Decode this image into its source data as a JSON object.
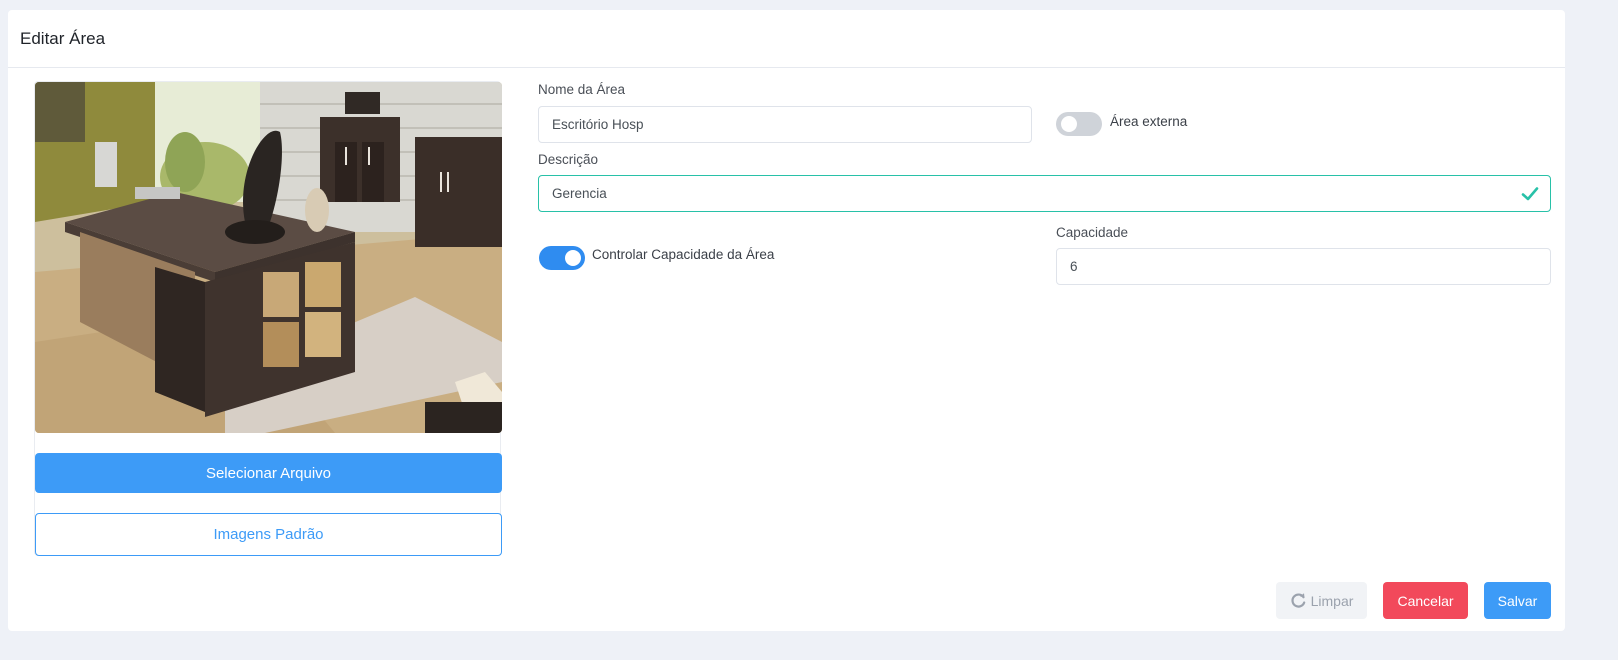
{
  "header": {
    "title": "Editar Área"
  },
  "image_panel": {
    "select_file_label": "Selecionar Arquivo",
    "default_images_label": "Imagens Padrão"
  },
  "form": {
    "area_name": {
      "label": "Nome da Área",
      "value": "Escritório Hosp"
    },
    "external_area": {
      "label": "Área externa",
      "checked": false
    },
    "description": {
      "label": "Descrição",
      "value": "Gerencia",
      "valid": true
    },
    "control_capacity": {
      "label": "Controlar Capacidade da Área",
      "checked": true
    },
    "capacity": {
      "label": "Capacidade",
      "value": "6"
    }
  },
  "actions": {
    "reset_label": "Limpar",
    "cancel_label": "Cancelar",
    "save_label": "Salvar"
  },
  "colors": {
    "primary": "#3d9bf7",
    "danger": "#f2495b",
    "valid": "#28c1a8",
    "toggle_on": "#2f8cf0",
    "toggle_off": "#cfd3d9"
  },
  "icons": {
    "valid": "check-icon",
    "reset": "refresh-icon"
  }
}
